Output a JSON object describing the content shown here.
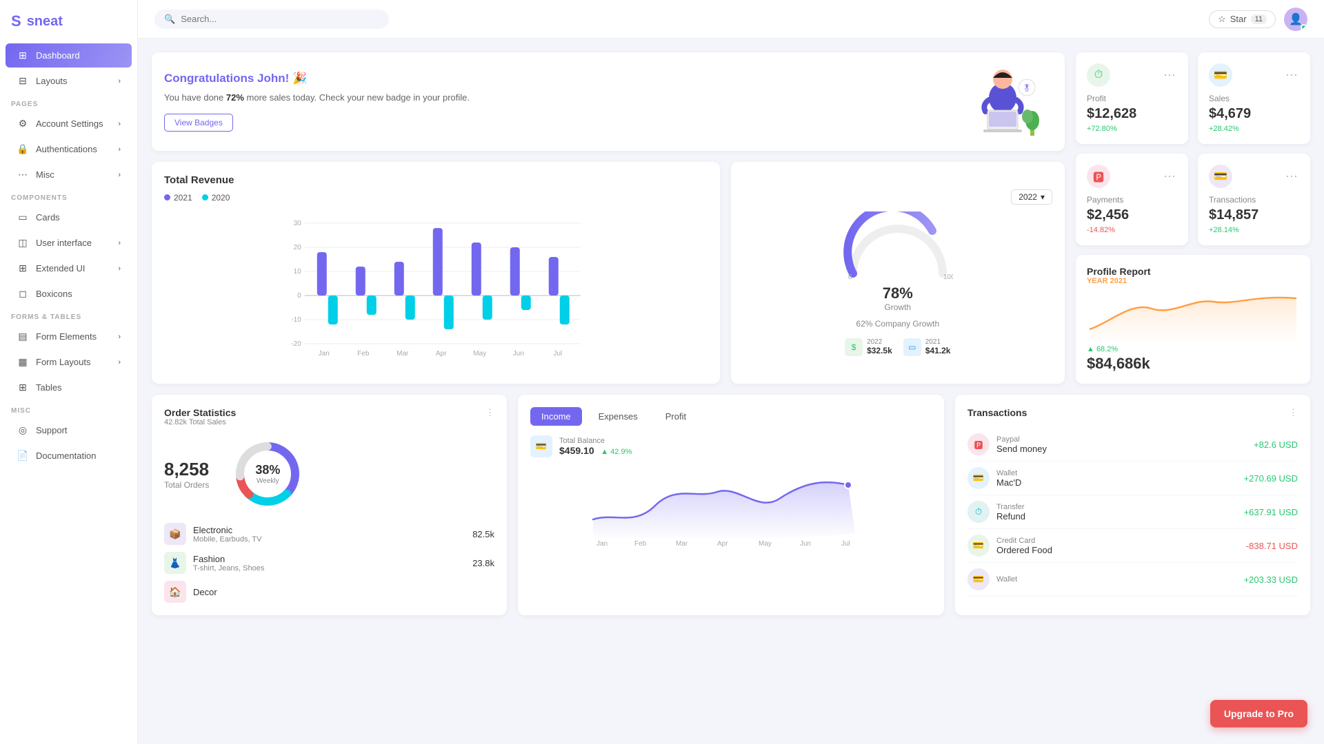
{
  "app": {
    "name": "sneat"
  },
  "header": {
    "search_placeholder": "Search...",
    "star_label": "Star",
    "star_count": "11"
  },
  "sidebar": {
    "pages_label": "PAGES",
    "components_label": "COMPONENTS",
    "forms_label": "FORMS & TABLES",
    "misc_label": "MISC",
    "items": [
      {
        "id": "dashboard",
        "label": "Dashboard",
        "icon": "⊞",
        "active": true
      },
      {
        "id": "layouts",
        "label": "Layouts",
        "icon": "⊟",
        "has_chevron": true
      },
      {
        "id": "account-settings",
        "label": "Account Settings",
        "icon": "⚙",
        "has_chevron": true
      },
      {
        "id": "authentications",
        "label": "Authentications",
        "icon": "🔒",
        "has_chevron": true
      },
      {
        "id": "misc",
        "label": "Misc",
        "icon": "⋯",
        "has_chevron": true
      },
      {
        "id": "cards",
        "label": "Cards",
        "icon": "▭"
      },
      {
        "id": "user-interface",
        "label": "User interface",
        "icon": "◫",
        "has_chevron": true
      },
      {
        "id": "extended-ui",
        "label": "Extended UI",
        "icon": "⊞",
        "has_chevron": true
      },
      {
        "id": "boxicons",
        "label": "Boxicons",
        "icon": "◻"
      },
      {
        "id": "form-elements",
        "label": "Form Elements",
        "icon": "▤",
        "has_chevron": true
      },
      {
        "id": "form-layouts",
        "label": "Form Layouts",
        "icon": "▦",
        "has_chevron": true
      },
      {
        "id": "tables",
        "label": "Tables",
        "icon": "⊞"
      },
      {
        "id": "support",
        "label": "Support",
        "icon": "◎"
      },
      {
        "id": "documentation",
        "label": "Documentation",
        "icon": "📄"
      }
    ]
  },
  "congrats": {
    "title": "Congratulations John! 🎉",
    "text_before": "You have done ",
    "highlight": "72%",
    "text_after": " more sales today. Check your new badge in your profile.",
    "button_label": "View Badges"
  },
  "stats": [
    {
      "id": "profit",
      "label": "Profit",
      "value": "$12,628",
      "change": "+72.80%",
      "change_type": "up",
      "icon": "⏱",
      "icon_class": "green"
    },
    {
      "id": "sales",
      "label": "Sales",
      "value": "$4,679",
      "change": "+28.42%",
      "change_type": "up",
      "icon": "💳",
      "icon_class": "blue"
    },
    {
      "id": "payments",
      "label": "Payments",
      "value": "$2,456",
      "change": "-14.82%",
      "change_type": "down",
      "icon": "🅿",
      "icon_class": "red"
    },
    {
      "id": "transactions",
      "label": "Transactions",
      "value": "$14,857",
      "change": "+28.14%",
      "change_type": "up",
      "icon": "💳",
      "icon_class": "purple"
    }
  ],
  "revenue": {
    "title": "Total Revenue",
    "legend": [
      {
        "label": "2021",
        "color": "#7367f0"
      },
      {
        "label": "2020",
        "color": "#00cfe8"
      }
    ],
    "months": [
      "Jan",
      "Feb",
      "Mar",
      "Apr",
      "May",
      "Jun",
      "Jul"
    ],
    "data_2021": [
      18,
      12,
      14,
      28,
      22,
      20,
      16
    ],
    "data_2020": [
      -12,
      -8,
      -10,
      -14,
      -10,
      -6,
      -12
    ]
  },
  "growth": {
    "year": "2022",
    "percent": "78%",
    "label": "Growth",
    "company_text": "62% Company Growth",
    "years": [
      {
        "label": "2022",
        "value": "$32.5k",
        "icon": "$",
        "bg": "#e8f5e9",
        "color": "#28c76f"
      },
      {
        "label": "2021",
        "value": "$41.2k",
        "icon": "▭",
        "bg": "#e3f2fd",
        "color": "#2196f3"
      }
    ]
  },
  "order_stats": {
    "title": "Order Statistics",
    "subtitle": "42.82k Total Sales",
    "total_orders": "8,258",
    "total_label": "Total Orders",
    "donut_pct": "38%",
    "donut_sub": "Weekly",
    "items": [
      {
        "name": "Electronic",
        "sub": "Mobile, Earbuds, TV",
        "count": "82.5k",
        "icon": "📦",
        "icon_class": "purple-bg"
      },
      {
        "name": "Fashion",
        "sub": "T-shirt, Jeans, Shoes",
        "count": "23.8k",
        "icon": "👗",
        "icon_class": "green-bg"
      },
      {
        "name": "Decor",
        "sub": "",
        "count": "",
        "icon": "🏠",
        "icon_class": "red-bg"
      }
    ]
  },
  "income": {
    "tabs": [
      "Income",
      "Expenses",
      "Profit"
    ],
    "active_tab": "Income",
    "balance_label": "Total Balance",
    "balance_value": "$459.10",
    "balance_change": "▲ 42.9%"
  },
  "profile_report": {
    "title": "Profile Report",
    "year_label": "YEAR 2021",
    "change": "▲ 68.2%",
    "value": "$84,686k"
  },
  "transactions": {
    "title": "Transactions",
    "items": [
      {
        "source": "Paypal",
        "name": "Send money",
        "amount": "+82.6 USD",
        "type": "positive",
        "icon": "🅿",
        "icon_class": "red-icon"
      },
      {
        "source": "Wallet",
        "name": "Mac'D",
        "amount": "+270.69 USD",
        "type": "positive",
        "icon": "💳",
        "icon_class": "blue-icon"
      },
      {
        "source": "Transfer",
        "name": "Refund",
        "amount": "+637.91 USD",
        "type": "positive",
        "icon": "⏱",
        "icon_class": "teal-icon"
      },
      {
        "source": "Credit Card",
        "name": "Ordered Food",
        "amount": "-838.71 USD",
        "type": "negative",
        "icon": "💳",
        "icon_class": "green-icon"
      },
      {
        "source": "Wallet",
        "name": "",
        "amount": "+203.33 USD",
        "type": "positive",
        "icon": "💳",
        "icon_class": "purple-icon"
      }
    ]
  },
  "upgrade": {
    "label": "Upgrade to Pro"
  }
}
